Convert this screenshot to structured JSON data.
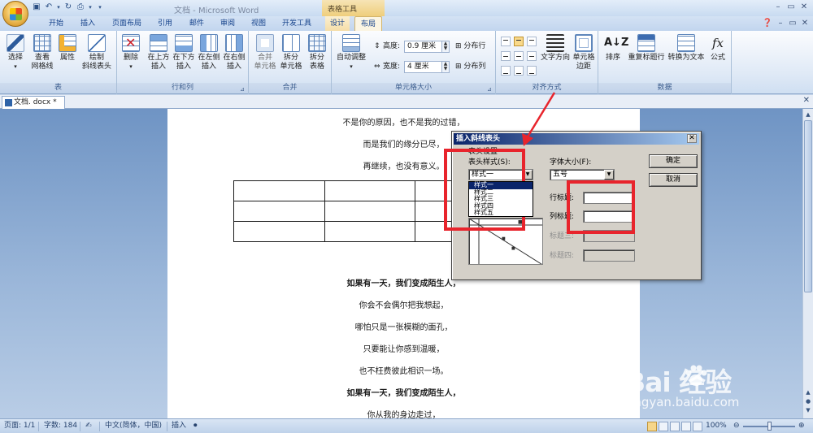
{
  "window": {
    "title": "文档 - Microsoft Word",
    "contextual_tab_group": "表格工具"
  },
  "quick_access": [
    "save-icon",
    "undo-icon",
    "redo-icon",
    "print-preview-icon",
    "customize-icon"
  ],
  "window_controls": [
    "minimize-icon",
    "maximize-icon",
    "close-icon"
  ],
  "ribbon_tabs": [
    {
      "label": "开始",
      "active": false
    },
    {
      "label": "插入",
      "active": false
    },
    {
      "label": "页面布局",
      "active": false
    },
    {
      "label": "引用",
      "active": false
    },
    {
      "label": "邮件",
      "active": false
    },
    {
      "label": "审阅",
      "active": false
    },
    {
      "label": "视图",
      "active": false
    },
    {
      "label": "开发工具",
      "active": false
    },
    {
      "label": "设计",
      "active": false
    },
    {
      "label": "布局",
      "active": true
    }
  ],
  "ribbon": {
    "table_group": {
      "label": "表",
      "select": "选择",
      "view_gridlines_1": "查看",
      "view_gridlines_2": "网格线",
      "properties": "属性",
      "draw_diagonal_1": "绘制",
      "draw_diagonal_2": "斜线表头"
    },
    "rows_cols_group": {
      "label": "行和列",
      "delete": "删除",
      "insert_above_1": "在上方",
      "insert_above_2": "插入",
      "insert_below_1": "在下方",
      "insert_below_2": "插入",
      "insert_left_1": "在左侧",
      "insert_left_2": "插入",
      "insert_right_1": "在右侧",
      "insert_right_2": "插入"
    },
    "merge_group": {
      "label": "合并",
      "merge_cells_1": "合并",
      "merge_cells_2": "单元格",
      "split_cells_1": "拆分",
      "split_cells_2": "单元格",
      "split_table_1": "拆分",
      "split_table_2": "表格"
    },
    "cell_size_group": {
      "label": "单元格大小",
      "autofit": "自动调整",
      "height_label": "高度:",
      "height_value": "0.9 厘米",
      "width_label": "宽度:",
      "width_value": "4 厘米",
      "distribute_rows": "分布行",
      "distribute_cols": "分布列"
    },
    "alignment_group": {
      "label": "对齐方式",
      "text_direction": "文字方向",
      "cell_margins_1": "单元格",
      "cell_margins_2": "边距"
    },
    "data_group": {
      "label": "数据",
      "sort": "排序",
      "repeat_header": "重复标题行",
      "convert_to_text": "转换为文本",
      "formula": "公式"
    }
  },
  "document_tab": "文档. docx *",
  "document": {
    "lines_top": [
      "不是你的原因，也不是我的过错，",
      "而是我们的缘分已尽，",
      "再继续，也没有意义。"
    ],
    "table_rows": 3,
    "table_cols": 3,
    "lines_bottom": [
      {
        "text": "如果有一天，我们变成陌生人，",
        "bold": true
      },
      {
        "text": "你会不会偶尔把我想起，",
        "bold": false
      },
      {
        "text": "哪怕只是一张模糊的面孔，",
        "bold": false
      },
      {
        "text": "只要能让你感到温暖，",
        "bold": false
      },
      {
        "text": "也不枉费彼此相识一场。",
        "bold": false
      },
      {
        "text": "如果有一天，我们变成陌生人，",
        "bold": true
      },
      {
        "text": "你从我的身边走过，",
        "bold": false
      }
    ]
  },
  "dialog": {
    "title": "插入斜线表头",
    "settings_group": "表头设置",
    "style_label": "表头样式(S):",
    "style_value": "样式一",
    "style_options": [
      "样式一",
      "样式二",
      "样式三",
      "样式四",
      "样式五"
    ],
    "style_selected_index": 0,
    "font_size_label": "字体大小(F):",
    "font_size_value": "五号",
    "row_title_label": "行标题:",
    "col_title_label": "列标题:",
    "title3_label": "标题三:",
    "title4_label": "标题四:",
    "ok": "确定",
    "cancel": "取消"
  },
  "status_bar": {
    "page": "页面: 1/1",
    "word_count": "字数: 184",
    "language": "中文(简体，中国)",
    "mode": "插入",
    "zoom": "100%"
  },
  "annotations": {
    "color": "#e8242c"
  },
  "watermark": {
    "brand": "Bai  经验",
    "url": "jingyan.baidu.com"
  }
}
